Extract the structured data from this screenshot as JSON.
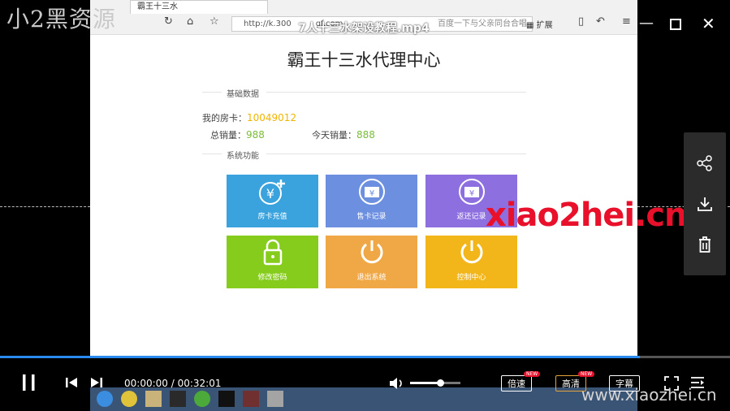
{
  "watermark": {
    "top_left": "小2黑资源",
    "center_right": "xiao2hei.cn",
    "bottom_right": "www.xiaozhei.cn"
  },
  "video": {
    "title": "7人十三水架设教程.mp4",
    "current_time": "00:00:00",
    "duration": "00:32:01",
    "time_sep": " / ",
    "progress": 0.877
  },
  "browser": {
    "tab_title": "霸王十三水",
    "address": "http://k.300",
    "address_tail": "gf.com",
    "extensions_label": "扩展",
    "search_hint": "百度一下与父亲同台合唱"
  },
  "page": {
    "title": "霸王十三水代理中心",
    "basic_section": "基础数据",
    "room_card_label": "我的房卡：",
    "room_card_value": "10049012",
    "total_sales_label": "总销量：",
    "total_sales_value": "988",
    "today_sales_label": "今天销量：",
    "today_sales_value": "888",
    "functions_section": "系统功能",
    "tiles": [
      {
        "label": "房卡充值",
        "color": "#3aa3dd",
        "icon": "yen-plus-icon"
      },
      {
        "label": "售卡记录",
        "color": "#6c8fe0",
        "icon": "yen-ticket-icon"
      },
      {
        "label": "返还记录",
        "color": "#8e6fe0",
        "icon": "yen-ticket-icon"
      },
      {
        "label": "修改密码",
        "color": "#86cc1c",
        "icon": "lock-icon"
      },
      {
        "label": "退出系统",
        "color": "#f0a846",
        "icon": "power-icon"
      },
      {
        "label": "控制中心",
        "color": "#f2b61b",
        "icon": "power-icon"
      }
    ]
  },
  "player": {
    "speed_label": "倍速",
    "quality_label": "高清",
    "subtitle_label": "字幕",
    "new_badge": "NEW",
    "volume": 0.6
  }
}
